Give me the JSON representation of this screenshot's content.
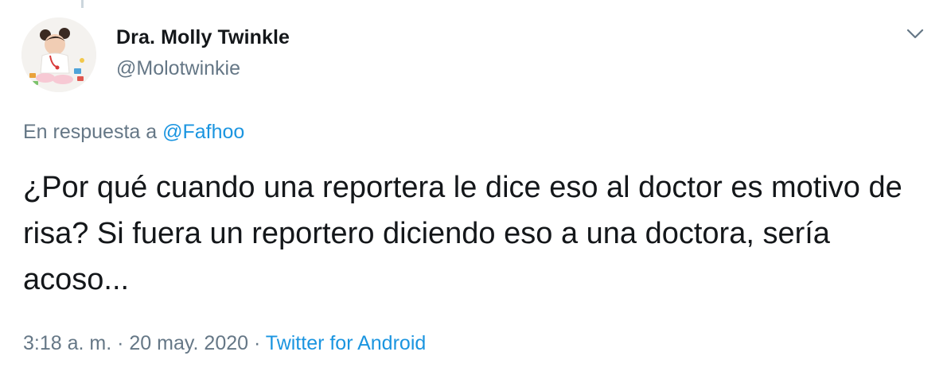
{
  "author": {
    "name": "Dra. Molly Twinkle",
    "handle": "@Molotwinkie"
  },
  "reply": {
    "prefix": "En respuesta a ",
    "mention": "@Fafhoo"
  },
  "tweet": {
    "text": "¿Por qué cuando una reportera le dice eso al doctor es motivo de risa? Si fuera un reportero diciendo eso a una doctora, sería acoso..."
  },
  "meta": {
    "time": "3:18 a. m.",
    "separator_1": " · ",
    "date": "20 may. 2020",
    "separator_2": " · ",
    "source": "Twitter for Android"
  },
  "icons": {
    "menu": "chevron-down-icon"
  },
  "colors": {
    "text": "#14171a",
    "secondary": "#657786",
    "link": "#1b95e0"
  }
}
